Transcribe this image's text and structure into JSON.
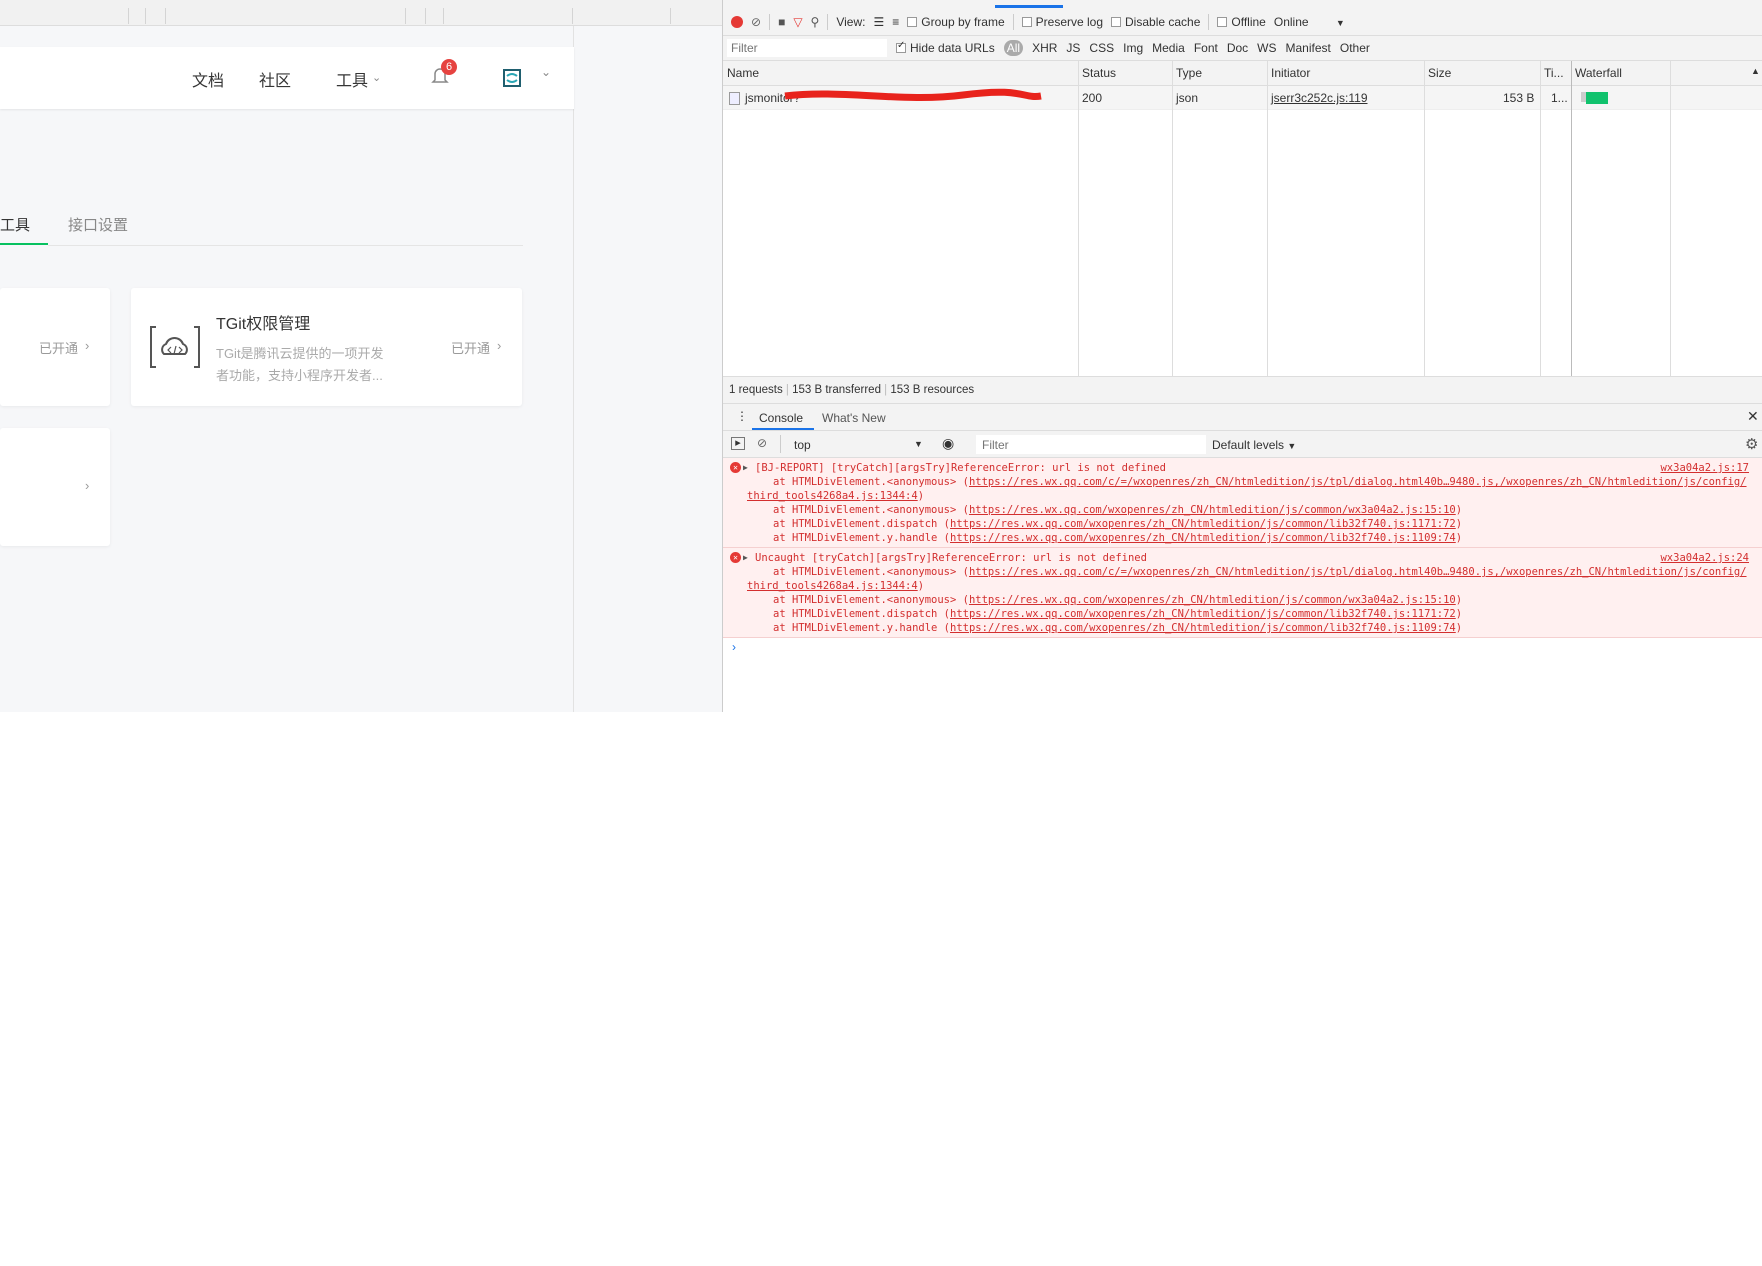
{
  "page": {
    "nav": [
      "文档",
      "社区",
      "工具"
    ],
    "notification_count": "6",
    "tabs": [
      "工具",
      "接口设置"
    ],
    "cards": [
      {
        "status": "已开通"
      },
      {
        "title": "TGit权限管理",
        "description_line1": "TGit是腾讯云提供的一项开发",
        "description_line2": "者功能，支持小程序开发者...",
        "status": "已开通"
      },
      {
        "status": ""
      }
    ],
    "accent": "#07c160"
  },
  "devtools": {
    "toolbar": {
      "view_label": "View:",
      "group_by_frame": "Group by frame",
      "preserve_log": "Preserve log",
      "disable_cache": "Disable cache",
      "offline": "Offline",
      "throttle": "Online"
    },
    "filter_placeholder": "Filter",
    "hide_data_urls": "Hide data URLs",
    "types": [
      "All",
      "XHR",
      "JS",
      "CSS",
      "Img",
      "Media",
      "Font",
      "Doc",
      "WS",
      "Manifest",
      "Other"
    ],
    "columns": [
      "Name",
      "Status",
      "Type",
      "Initiator",
      "Size",
      "Ti...",
      "Waterfall"
    ],
    "requests": [
      {
        "name": "jsmonitor?",
        "status": "200",
        "type": "json",
        "initiator": "jserr3c252c.js:119",
        "size": "153 B",
        "time": "1..."
      }
    ],
    "summary": {
      "requests": "1 requests",
      "transferred": "153 B transferred",
      "resources": "153 B resources"
    },
    "drawer_tabs": [
      "Console",
      "What's New"
    ],
    "console": {
      "context": "top",
      "filter_placeholder": "Filter",
      "levels": "Default levels",
      "messages": [
        {
          "text": "[BJ-REPORT] [tryCatch][argsTry]ReferenceError: url is not defined",
          "source": "wx3a04a2.js:17",
          "frames": [
            {
              "pre": "at HTMLDivElement.<anonymous> (",
              "url": "https://res.wx.qq.com/c/=/wxopenres/zh_CN/htmledition/js/tpl/dialog.html40b…9480.js,/wxopenres/zh_CN/htmledition/js/config/third_tools4268a4.js:1344:4"
            },
            {
              "pre": "at HTMLDivElement.<anonymous> (",
              "url": "https://res.wx.qq.com/wxopenres/zh_CN/htmledition/js/common/wx3a04a2.js:15:10"
            },
            {
              "pre": "at HTMLDivElement.dispatch (",
              "url": "https://res.wx.qq.com/wxopenres/zh_CN/htmledition/js/common/lib32f740.js:1171:72"
            },
            {
              "pre": "at HTMLDivElement.y.handle (",
              "url": "https://res.wx.qq.com/wxopenres/zh_CN/htmledition/js/common/lib32f740.js:1109:74"
            }
          ]
        },
        {
          "text": "Uncaught [tryCatch][argsTry]ReferenceError: url is not defined",
          "source": "wx3a04a2.js:24",
          "frames": [
            {
              "pre": "at HTMLDivElement.<anonymous> (",
              "url": "https://res.wx.qq.com/c/=/wxopenres/zh_CN/htmledition/js/tpl/dialog.html40b…9480.js,/wxopenres/zh_CN/htmledition/js/config/third_tools4268a4.js:1344:4"
            },
            {
              "pre": "at HTMLDivElement.<anonymous> (",
              "url": "https://res.wx.qq.com/wxopenres/zh_CN/htmledition/js/common/wx3a04a2.js:15:10"
            },
            {
              "pre": "at HTMLDivElement.dispatch (",
              "url": "https://res.wx.qq.com/wxopenres/zh_CN/htmledition/js/common/lib32f740.js:1171:72"
            },
            {
              "pre": "at HTMLDivElement.y.handle (",
              "url": "https://res.wx.qq.com/wxopenres/zh_CN/htmledition/js/common/lib32f740.js:1109:74"
            }
          ]
        }
      ]
    }
  }
}
